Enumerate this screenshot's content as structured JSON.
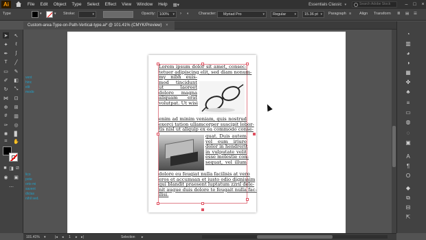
{
  "app": {
    "logo": "Ai"
  },
  "menu": [
    "File",
    "Edit",
    "Object",
    "Type",
    "Select",
    "Effect",
    "View",
    "Window",
    "Help"
  ],
  "workspace": {
    "label": "Essentials Classic",
    "search_placeholder": "Search Adobe Stock"
  },
  "control_bar": {
    "selection_label": "Type",
    "stroke_label": "Stroke:",
    "opacity_label": "Opacity:",
    "opacity_value": "100%",
    "character_label": "Character:",
    "font_family": "Myriad Pro",
    "font_style": "Regular",
    "font_size": "15.36 pt",
    "paragraph_label": "Paragraph",
    "align_label": "Align",
    "transform_label": "Transform"
  },
  "document_tab": {
    "title": "Custom-area-Type-on-Path-Vertical-type.ai* @ 101.41% (CMYK/Preview)",
    "close": "×"
  },
  "overflow_text": [
    "vent",
    "hinc",
    "elit",
    "modo",
    "lico",
    "pote",
    "orto mi",
    "savent",
    "dictas",
    "nihil sed."
  ],
  "body_text": {
    "top_lines": [
      "Lorem ipsum dolor sit amet, consec-",
      "tetuer adipiscing elit, sed diam nonum-",
      "my nibh euis-",
      "mod tincidunt",
      "ut laoreet",
      "dolore magna",
      "aliquam erat",
      "volutpat. Ut wisi",
      "enim ad minim veniam, quis nostrud",
      "exerci tation ullamcorper suscipit lobor-",
      "tis nisl ut aliquip ex ea commodo conse-"
    ],
    "middle_lines": [
      "quat. Duis autem",
      "vel eum iriure",
      "dolor in hendrerit",
      "in vulputate velit",
      "esse molestie con-",
      "sequat, vel illum"
    ],
    "bottom_lines": [
      "dolore eu feugiat nulla facilisis at vero",
      "eros et accumsan et iusto odio dignissim",
      "qui blandit praesent luptatum zzril dele-",
      "nit augue duis dolore te feugait nulla fac-",
      "ilisi."
    ]
  },
  "status_bar": {
    "zoom": "101.41%",
    "page": "1",
    "tool": "Selection"
  },
  "colors": {
    "accent": "#ff9a00",
    "selection": "#e05060",
    "overflow": "#21a0c8"
  }
}
